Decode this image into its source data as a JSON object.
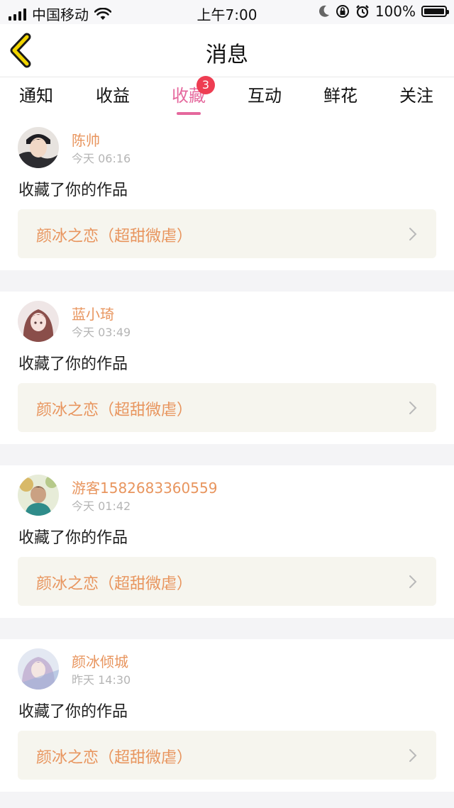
{
  "status_bar": {
    "carrier": "中国移动",
    "time": "上午7:00",
    "battery": "100%"
  },
  "nav": {
    "title": "消息"
  },
  "tabs": [
    {
      "label": "通知",
      "active": false
    },
    {
      "label": "收益",
      "active": false
    },
    {
      "label": "收藏",
      "active": true,
      "badge": "3"
    },
    {
      "label": "互动",
      "active": false
    },
    {
      "label": "鲜花",
      "active": false
    },
    {
      "label": "关注",
      "active": false
    }
  ],
  "messages": [
    {
      "user": "陈帅",
      "time": "今天 06:16",
      "action": "收藏了你的作品",
      "work": "颜冰之恋（超甜微虐）"
    },
    {
      "user": "蓝小琦",
      "time": "今天 03:49",
      "action": "收藏了你的作品",
      "work": "颜冰之恋（超甜微虐）"
    },
    {
      "user": "游客1582683360559",
      "time": "今天 01:42",
      "action": "收藏了你的作品",
      "work": "颜冰之恋（超甜微虐）"
    },
    {
      "user": "颜冰倾城",
      "time": "昨天 14:30",
      "action": "收藏了你的作品",
      "work": "颜冰之恋（超甜微虐）"
    }
  ],
  "colors": {
    "accent_pink": "#e5689d",
    "name_orange": "#e8955e",
    "badge_red": "#ee3d52",
    "back_yellow": "#f1d500"
  }
}
